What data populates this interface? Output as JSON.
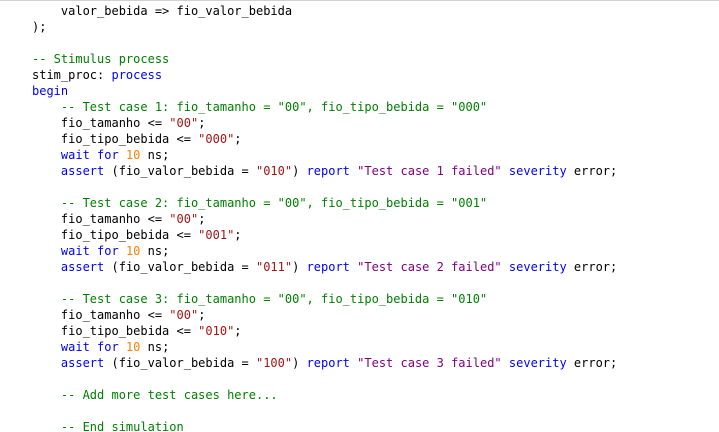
{
  "colors": {
    "background": "#ffffff",
    "default": "#000000",
    "comment": "#008000",
    "keyword": "#0000ff",
    "string": "#a31515",
    "number": "#ff8000",
    "report_string": "#800080"
  },
  "lines": [
    [
      {
        "t": "    valor_bebida => fio_valor_bebida",
        "c": "default"
      }
    ],
    [
      {
        "t": ");",
        "c": "default"
      }
    ],
    [],
    [
      {
        "t": "-- Stimulus process",
        "c": "comment"
      }
    ],
    [
      {
        "t": "stim_proc: ",
        "c": "default"
      },
      {
        "t": "process",
        "c": "keyword"
      }
    ],
    [
      {
        "t": "begin",
        "c": "keyword"
      }
    ],
    [
      {
        "t": "    ",
        "c": "default"
      },
      {
        "t": "-- Test case 1: fio_tamanho = \"00\", fio_tipo_bebida = \"000\"",
        "c": "comment"
      }
    ],
    [
      {
        "t": "    fio_tamanho <= ",
        "c": "default"
      },
      {
        "t": "\"00\"",
        "c": "string"
      },
      {
        "t": ";",
        "c": "default"
      }
    ],
    [
      {
        "t": "    fio_tipo_bebida <= ",
        "c": "default"
      },
      {
        "t": "\"000\"",
        "c": "string"
      },
      {
        "t": ";",
        "c": "default"
      }
    ],
    [
      {
        "t": "    ",
        "c": "default"
      },
      {
        "t": "wait for ",
        "c": "keyword"
      },
      {
        "t": "10",
        "c": "number"
      },
      {
        "t": " ns;",
        "c": "default"
      }
    ],
    [
      {
        "t": "    ",
        "c": "default"
      },
      {
        "t": "assert",
        "c": "keyword"
      },
      {
        "t": " (fio_valor_bebida = ",
        "c": "default"
      },
      {
        "t": "\"010\"",
        "c": "string"
      },
      {
        "t": ") ",
        "c": "default"
      },
      {
        "t": "report",
        "c": "keyword"
      },
      {
        "t": " ",
        "c": "default"
      },
      {
        "t": "\"Test case 1 failed\"",
        "c": "report_string"
      },
      {
        "t": " ",
        "c": "default"
      },
      {
        "t": "severity",
        "c": "keyword"
      },
      {
        "t": " error;",
        "c": "default"
      }
    ],
    [],
    [
      {
        "t": "    ",
        "c": "default"
      },
      {
        "t": "-- Test case 2: fio_tamanho = \"00\", fio_tipo_bebida = \"001\"",
        "c": "comment"
      }
    ],
    [
      {
        "t": "    fio_tamanho <= ",
        "c": "default"
      },
      {
        "t": "\"00\"",
        "c": "string"
      },
      {
        "t": ";",
        "c": "default"
      }
    ],
    [
      {
        "t": "    fio_tipo_bebida <= ",
        "c": "default"
      },
      {
        "t": "\"001\"",
        "c": "string"
      },
      {
        "t": ";",
        "c": "default"
      }
    ],
    [
      {
        "t": "    ",
        "c": "default"
      },
      {
        "t": "wait for ",
        "c": "keyword"
      },
      {
        "t": "10",
        "c": "number"
      },
      {
        "t": " ns;",
        "c": "default"
      }
    ],
    [
      {
        "t": "    ",
        "c": "default"
      },
      {
        "t": "assert",
        "c": "keyword"
      },
      {
        "t": " (fio_valor_bebida = ",
        "c": "default"
      },
      {
        "t": "\"011\"",
        "c": "string"
      },
      {
        "t": ") ",
        "c": "default"
      },
      {
        "t": "report",
        "c": "keyword"
      },
      {
        "t": " ",
        "c": "default"
      },
      {
        "t": "\"Test case 2 failed\"",
        "c": "report_string"
      },
      {
        "t": " ",
        "c": "default"
      },
      {
        "t": "severity",
        "c": "keyword"
      },
      {
        "t": " error;",
        "c": "default"
      }
    ],
    [],
    [
      {
        "t": "    ",
        "c": "default"
      },
      {
        "t": "-- Test case 3: fio_tamanho = \"00\", fio_tipo_bebida = \"010\"",
        "c": "comment"
      }
    ],
    [
      {
        "t": "    fio_tamanho <= ",
        "c": "default"
      },
      {
        "t": "\"00\"",
        "c": "string"
      },
      {
        "t": ";",
        "c": "default"
      }
    ],
    [
      {
        "t": "    fio_tipo_bebida <= ",
        "c": "default"
      },
      {
        "t": "\"010\"",
        "c": "string"
      },
      {
        "t": ";",
        "c": "default"
      }
    ],
    [
      {
        "t": "    ",
        "c": "default"
      },
      {
        "t": "wait for ",
        "c": "keyword"
      },
      {
        "t": "10",
        "c": "number"
      },
      {
        "t": " ns;",
        "c": "default"
      }
    ],
    [
      {
        "t": "    ",
        "c": "default"
      },
      {
        "t": "assert",
        "c": "keyword"
      },
      {
        "t": " (fio_valor_bebida = ",
        "c": "default"
      },
      {
        "t": "\"100\"",
        "c": "string"
      },
      {
        "t": ") ",
        "c": "default"
      },
      {
        "t": "report",
        "c": "keyword"
      },
      {
        "t": " ",
        "c": "default"
      },
      {
        "t": "\"Test case 3 failed\"",
        "c": "report_string"
      },
      {
        "t": " ",
        "c": "default"
      },
      {
        "t": "severity",
        "c": "keyword"
      },
      {
        "t": " error;",
        "c": "default"
      }
    ],
    [],
    [
      {
        "t": "    ",
        "c": "default"
      },
      {
        "t": "-- Add more test cases here...",
        "c": "comment"
      }
    ],
    [],
    [
      {
        "t": "    ",
        "c": "default"
      },
      {
        "t": "-- End simulation",
        "c": "comment"
      }
    ]
  ]
}
